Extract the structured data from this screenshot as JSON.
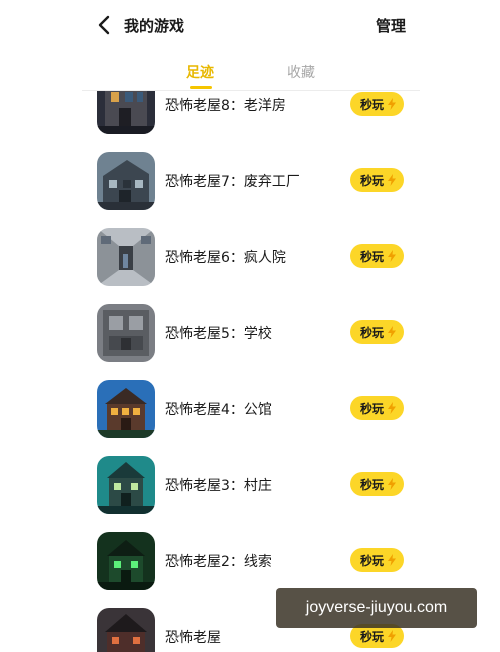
{
  "header": {
    "back_icon": "chevron-left-icon",
    "title": "我的游戏",
    "manage_label": "管理"
  },
  "tabs": [
    {
      "label": "足迹",
      "active": true
    },
    {
      "label": "收藏",
      "active": false
    }
  ],
  "colors": {
    "accent": "#f5c500",
    "play_button": "#fcd628",
    "inactive_tab": "#a7a7a7"
  },
  "games": [
    {
      "name": "恐怖老屋8：老洋房",
      "play_label": "秒玩"
    },
    {
      "name": "恐怖老屋7：废弃工厂",
      "play_label": "秒玩"
    },
    {
      "name": "恐怖老屋6：疯人院",
      "play_label": "秒玩"
    },
    {
      "name": "恐怖老屋5：学校",
      "play_label": "秒玩"
    },
    {
      "name": "恐怖老屋4：公馆",
      "play_label": "秒玩"
    },
    {
      "name": "恐怖老屋3：村庄",
      "play_label": "秒玩"
    },
    {
      "name": "恐怖老屋2：线索",
      "play_label": "秒玩"
    },
    {
      "name": "恐怖老屋",
      "play_label": "秒玩"
    }
  ],
  "watermark": "joyverse-jiuyou.com"
}
